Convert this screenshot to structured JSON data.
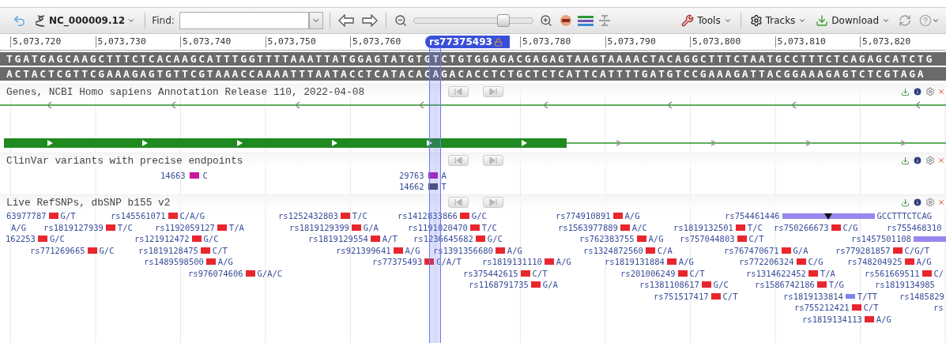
{
  "toolbar": {
    "sequence": "NC_000009.12",
    "find_label": "Find:",
    "menus": [
      {
        "label": "Tools",
        "kind": "tools"
      },
      {
        "label": "Tracks",
        "kind": "tracks"
      },
      {
        "label": "Download",
        "kind": "download"
      }
    ]
  },
  "zoom": {
    "level": 0.75
  },
  "ruler": {
    "ticks": [
      "5,073,720",
      "5,073,730",
      "5,073,740",
      "5,073,750",
      "5,073,760",
      "5,073,780",
      "5,073,790",
      "5,073,800",
      "5,073,810",
      "5,073,820"
    ],
    "marker": "rs77375493"
  },
  "sequence": {
    "forward": "TGATGAGCAAGCTTTCTCACAAGCATTTGGTTTTAAATTATGGAGTATGTGTCTGTGGAGACGAGAGTAAGTAAAACTACAGGCTTTCTAATGCCTTTCTCAGAGCATCTG",
    "reverse": "ACTACTCGTTCGAAAGAGTGTTCGTAAACCAAAATTTAATACCTCATACACAGACACCTCTGCTCTCATTCATTTTGATGTCCGAAAGATTACGGAAAGAGTCTCGTAGA"
  },
  "tracks": [
    {
      "kind": "genes",
      "title": "Genes, NCBI Homo sapiens Annotation Release 110, 2022-04-08"
    },
    {
      "kind": "clinvar",
      "title": "ClinVar variants with precise endpoints",
      "items": [
        {
          "id": "14663",
          "allele": "C",
          "color": "#c8189e"
        },
        {
          "id": "29763",
          "allele": "A",
          "color": "#b01ab8"
        },
        {
          "id": "14662",
          "allele": "T",
          "color": "#4a4868"
        }
      ]
    },
    {
      "kind": "snps",
      "title": "Live RefSNPs, dbSNP b155 v2",
      "items": [
        {
          "id": "63977787",
          "allele": "G/T",
          "kind": "snv"
        },
        {
          "id": "rs145561071",
          "allele": "C/A/G",
          "kind": "snv"
        },
        {
          "id": "rs1252432803",
          "allele": "T/C",
          "kind": "snv"
        },
        {
          "id": "rs1412833866",
          "allele": "G/C",
          "kind": "snv"
        },
        {
          "id": "rs774910891",
          "allele": "A/G",
          "kind": "snv"
        },
        {
          "id": "rs754461446",
          "allele": "GCCTTTCTCAG",
          "kind": "span"
        },
        {
          "allele": "A/G",
          "kind": "cut"
        },
        {
          "id": "rs1819127939",
          "allele": "T/C",
          "kind": "snv"
        },
        {
          "id": "rs1192059127",
          "allele": "T/A",
          "kind": "snv"
        },
        {
          "id": "rs1819129399",
          "allele": "G/A",
          "kind": "snv"
        },
        {
          "id": "rs1191020470",
          "allele": "T/C",
          "kind": "snv"
        },
        {
          "id": "rs1563977889",
          "allele": "A/C",
          "kind": "snv"
        },
        {
          "id": "rs1819132501",
          "allele": "T/C",
          "kind": "snv"
        },
        {
          "id": "rs750266673",
          "allele": "C/G",
          "kind": "snv"
        },
        {
          "id": "rs755468310",
          "kind": "cut"
        },
        {
          "id": "162253",
          "allele": "G/C",
          "kind": "snv"
        },
        {
          "id": "rs121912472",
          "allele": "G/C",
          "kind": "snv"
        },
        {
          "id": "rs1819129554",
          "allele": "A/T",
          "kind": "snv"
        },
        {
          "id": "rs1236645682",
          "allele": "G/C",
          "kind": "snv"
        },
        {
          "id": "rs762383755",
          "allele": "A/G",
          "kind": "snv"
        },
        {
          "id": "rs757044803",
          "allele": "C/T",
          "kind": "snv"
        },
        {
          "id": "rs1457501108",
          "kind": "span"
        },
        {
          "id": "rs771269665",
          "allele": "G/C",
          "kind": "snv"
        },
        {
          "id": "rs1819128475",
          "allele": "C/T",
          "kind": "snv"
        },
        {
          "id": "rs921399641",
          "allele": "A/G",
          "kind": "snv"
        },
        {
          "id": "rs1391356680",
          "allele": "A/G",
          "kind": "snv"
        },
        {
          "id": "rs1324872560",
          "allele": "C/A",
          "kind": "snv"
        },
        {
          "id": "rs767470671",
          "allele": "G/A",
          "kind": "snv"
        },
        {
          "id": "rs779281857",
          "allele": "C/G/T",
          "kind": "snv"
        },
        {
          "id": "rs1489598500",
          "allele": "A/G",
          "kind": "snv"
        },
        {
          "id": "rs77375493",
          "allele": "G/A/T",
          "kind": "snv"
        },
        {
          "id": "rs1819131110",
          "allele": "A/G",
          "kind": "snv"
        },
        {
          "id": "rs1819131884",
          "allele": "A/G",
          "kind": "snv"
        },
        {
          "id": "rs772206324",
          "allele": "C/G",
          "kind": "snv"
        },
        {
          "id": "rs748204925",
          "allele": "A/G",
          "kind": "snv"
        },
        {
          "id": "rs976074606",
          "allele": "G/A/C",
          "kind": "snv"
        },
        {
          "id": "rs375442615",
          "allele": "C/T",
          "kind": "snv"
        },
        {
          "id": "rs201006249",
          "allele": "C/T",
          "kind": "snv"
        },
        {
          "id": "rs1314622452",
          "allele": "T/A",
          "kind": "snv"
        },
        {
          "id": "rs561669511",
          "allele": "C/",
          "kind": "snv"
        },
        {
          "id": "rs1168791735",
          "allele": "G/A",
          "kind": "snv"
        },
        {
          "id": "rs1381108617",
          "allele": "G/C",
          "kind": "snv"
        },
        {
          "id": "rs1586742186",
          "allele": "T/G",
          "kind": "snv"
        },
        {
          "id": "rs1819134985",
          "kind": "cut"
        },
        {
          "id": "rs751517417",
          "allele": "C/T",
          "kind": "snv"
        },
        {
          "id": "rs1819133814",
          "allele": "T/TT",
          "kind": "ins"
        },
        {
          "id": "rs1485829",
          "kind": "cut"
        },
        {
          "id": "rs755212421",
          "allele": "C/T",
          "kind": "snv"
        },
        {
          "id": "rs",
          "kind": "cut"
        },
        {
          "id": "rs1819134113",
          "allele": "A/G",
          "kind": "snv"
        }
      ]
    }
  ]
}
